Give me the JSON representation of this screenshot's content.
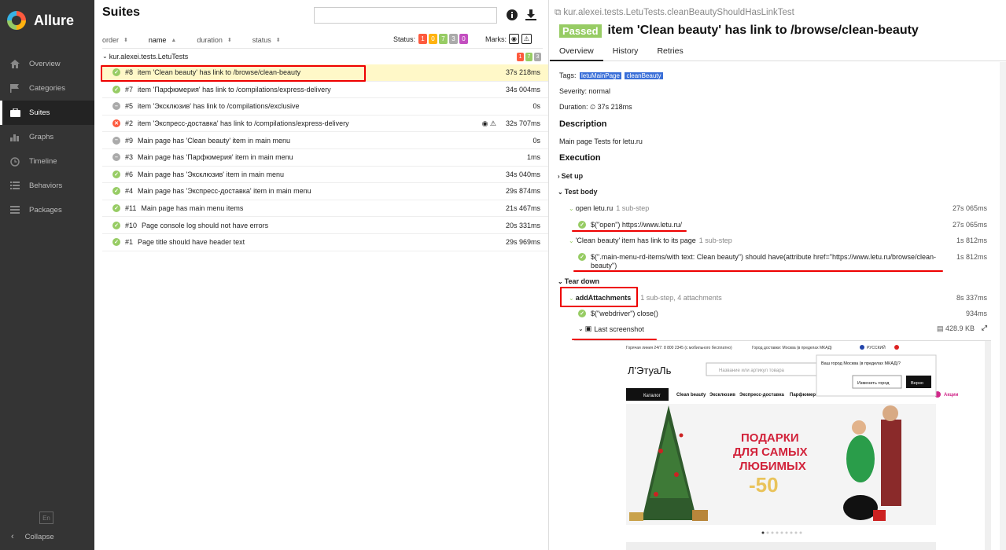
{
  "app": {
    "name": "Allure"
  },
  "sidebar": {
    "items": [
      {
        "label": "Overview",
        "icon": "home-icon"
      },
      {
        "label": "Categories",
        "icon": "flag-icon"
      },
      {
        "label": "Suites",
        "icon": "briefcase-icon"
      },
      {
        "label": "Graphs",
        "icon": "bar-chart-icon"
      },
      {
        "label": "Timeline",
        "icon": "clock-icon"
      },
      {
        "label": "Behaviors",
        "icon": "list-icon"
      },
      {
        "label": "Packages",
        "icon": "stack-icon"
      }
    ],
    "active": "Suites",
    "language": "En",
    "collapse_label": "Collapse"
  },
  "suites": {
    "title": "Suites",
    "search_value": "",
    "sort": {
      "order": "order",
      "name": "name",
      "duration": "duration",
      "status": "status"
    },
    "status_label": "Status:",
    "status_counts": [
      {
        "value": "1",
        "color": "#fd5a3e"
      },
      {
        "value": "0",
        "color": "#ffb20f"
      },
      {
        "value": "7",
        "color": "#97cc64"
      },
      {
        "value": "3",
        "color": "#aaaaaa"
      },
      {
        "value": "0",
        "color": "#c34fc0"
      }
    ],
    "marks_label": "Marks:",
    "group": {
      "name": "kur.alexei.tests.LetuTests",
      "counts": [
        {
          "value": "1",
          "color": "#fd5a3e"
        },
        {
          "value": "7",
          "color": "#97cc64"
        },
        {
          "value": "3",
          "color": "#aaaaaa"
        }
      ]
    },
    "rows": [
      {
        "status": "passed",
        "num": "#8",
        "name": "item 'Clean beauty' has link to /browse/clean-beauty",
        "duration": "37s 218ms",
        "selected": true
      },
      {
        "status": "passed",
        "num": "#7",
        "name": "item 'Парфюмерия' has link to /compilations/express-delivery",
        "duration": "34s 004ms"
      },
      {
        "status": "skipped",
        "num": "#5",
        "name": "item 'Эксклюзив' has link to /compilations/exclusive",
        "duration": "0s"
      },
      {
        "status": "failed",
        "num": "#2",
        "name": "item 'Экспресс-доставка' has link to /compilations/express-delivery",
        "duration": "32s 707ms",
        "flags": "◉  ⚠"
      },
      {
        "status": "skipped",
        "num": "#9",
        "name": "Main page has 'Clean beauty' item in main menu",
        "duration": "0s"
      },
      {
        "status": "skipped",
        "num": "#3",
        "name": "Main page has 'Парфюмерия' item in main menu",
        "duration": "1ms"
      },
      {
        "status": "passed",
        "num": "#6",
        "name": "Main page has 'Эксклюзив' item in main menu",
        "duration": "34s 040ms"
      },
      {
        "status": "passed",
        "num": "#4",
        "name": "Main page has 'Экспресс-доставка' item in main menu",
        "duration": "29s 874ms"
      },
      {
        "status": "passed",
        "num": "#11",
        "name": "Main page has main menu items",
        "duration": "21s 467ms"
      },
      {
        "status": "passed",
        "num": "#10",
        "name": "Page console log should not have errors",
        "duration": "20s 331ms"
      },
      {
        "status": "passed",
        "num": "#1",
        "name": "Page title should have header text",
        "duration": "29s 969ms"
      }
    ]
  },
  "detail": {
    "breadcrumb": "kur.alexei.tests.LetuTests.cleanBeautyShouldHasLinkTest",
    "status_badge": "Passed",
    "title": "item 'Clean beauty' has link to /browse/clean-beauty",
    "tabs": [
      "Overview",
      "History",
      "Retries"
    ],
    "tags_label": "Tags:",
    "tags": [
      "letuMainPage",
      "cleanBeauty"
    ],
    "severity": "Severity: normal",
    "duration_label": "Duration:",
    "duration": "37s 218ms",
    "description_heading": "Description",
    "description": "Main page Tests for letu.ru",
    "execution_heading": "Execution",
    "setup": "Set up",
    "test_body": "Test body",
    "steps": [
      {
        "name": "open letu.ru",
        "sub": "1 sub-step",
        "duration": "27s 065ms"
      },
      {
        "name": "$(\"open\") https://www.letu.ru/",
        "duration": "27s 065ms"
      },
      {
        "name": "'Clean beauty' item has link to its page",
        "sub": "1 sub-step",
        "duration": "1s 812ms"
      },
      {
        "name": "$(\".main-menu-rd-items/with text: Clean beauty\") should have(attribute href=\"https://www.letu.ru/browse/clean-",
        "name2": "beauty\")",
        "duration": "1s 812ms"
      }
    ],
    "teardown": "Tear down",
    "add_attachments": {
      "name": "addAttachments",
      "sub": "1 sub-step, 4 attachments",
      "duration": "8s 337ms"
    },
    "webdriver_close": {
      "name": "$(\"webdriver\") close()",
      "duration": "934ms"
    },
    "screenshot": {
      "name": "Last screenshot",
      "size": "428.9 KB"
    }
  },
  "screenshot_page": {
    "hotline": "Горячая линия 24/7: 8 800 2345 (с мобильного бесплатно)",
    "delivery": "Город доставки: Москва (в пределах МКАД)",
    "lang": "РУССКИЙ",
    "brand": "Л'ЭтуаЛь",
    "search_placeholder": "Название или артикул товара",
    "catalog": "Каталог",
    "menu": [
      "Clean beauty",
      "Эксклюзив",
      "Экспресс-доставка",
      "Парфюмерия"
    ],
    "promo": "Акции",
    "popup_text": "Ваш город Москва (в пределах МКАД)?",
    "popup_change": "Изменить город",
    "popup_ok": "Верно",
    "banner": [
      "ПОДАРКИ",
      "ДЛЯ САМЫХ",
      "ЛЮБИМЫХ"
    ],
    "discount": "-50"
  }
}
